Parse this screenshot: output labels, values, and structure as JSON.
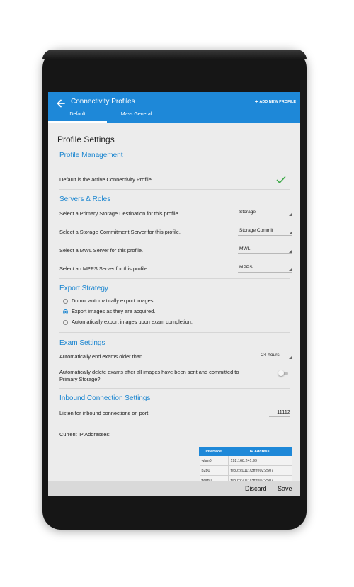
{
  "appbar": {
    "title": "Connectivity Profiles",
    "add_profile_label": "ADD NEW PROFILE",
    "tabs": [
      {
        "label": "Default",
        "active": true
      },
      {
        "label": "Mass General",
        "active": false
      }
    ],
    "color": "#1e88d8"
  },
  "page_title": "Profile Settings",
  "profile_management": {
    "heading": "Profile Management",
    "status_text": "Default is the active Connectivity Profile.",
    "status_icon": "check-icon",
    "status_color": "#3aa845"
  },
  "servers_roles": {
    "heading": "Servers & Roles",
    "rows": [
      {
        "label": "Select a Primary Storage Destination for this profile.",
        "value": "Storage"
      },
      {
        "label": "Select a Storage Commitment Server for this profile.",
        "value": "Storage Commit"
      },
      {
        "label": "Select a MWL Server for this profile.",
        "value": "MWL"
      },
      {
        "label": "Select an MPPS Server for this profile.",
        "value": "MPPS"
      }
    ]
  },
  "export_strategy": {
    "heading": "Export Strategy",
    "options": [
      {
        "label": "Do not automatically export images.",
        "checked": false
      },
      {
        "label": "Export images as they are acquired.",
        "checked": true
      },
      {
        "label": "Automatically export images upon exam completion.",
        "checked": false
      }
    ]
  },
  "exam_settings": {
    "heading": "Exam Settings",
    "auto_end_label": "Automatically end exams older than",
    "auto_end_value": "24 hours",
    "auto_delete_label_line1": "Automatically delete exams after all images have been sent and committed to",
    "auto_delete_label_line2": "Primary Storage?",
    "auto_delete_enabled": false
  },
  "inbound": {
    "heading": "Inbound Connection Settings",
    "port_label": "Listen for inbound connections on port:",
    "port_value": "11112",
    "ip_label": "Current IP Addresses:",
    "table_headers": [
      "Interface",
      "IP Address"
    ],
    "table_rows": [
      [
        "wlan0",
        "192.168.241.99"
      ],
      [
        "p2p0",
        "fe80::c011:73ff:fe02:2507"
      ],
      [
        "wlan0",
        "fe80::c211:73ff:fe02:2507"
      ]
    ]
  },
  "footer": {
    "discard_label": "Discard",
    "save_label": "Save"
  },
  "colors": {
    "accent": "#1a85d0",
    "screen_bg": "#ececec",
    "footer_bg": "#d9d9d9"
  }
}
